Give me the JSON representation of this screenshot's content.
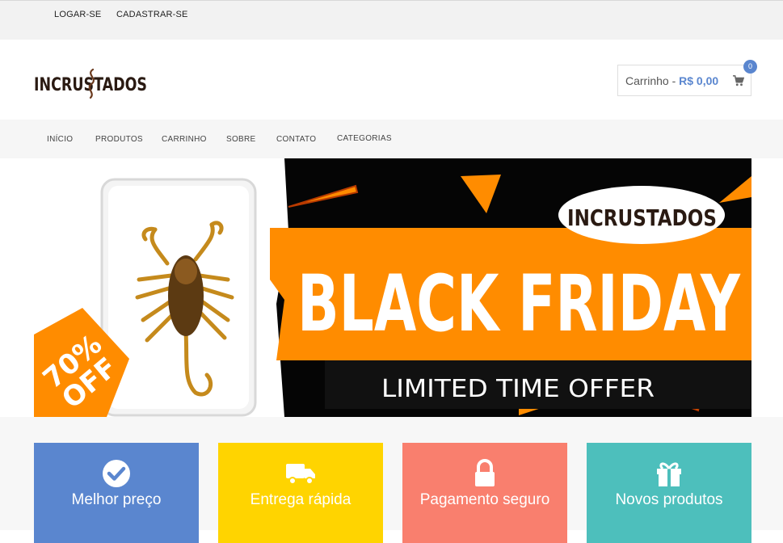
{
  "topbar": {
    "login": "LOGAR-SE",
    "signup": "CADASTRAR-SE"
  },
  "header": {
    "logo_text": "INCRUSTADOS",
    "cart": {
      "label": "Carrinho - ",
      "total": "R$ 0,00",
      "count": "0",
      "icon": "shopping-cart-icon"
    }
  },
  "nav": {
    "items": [
      "INÍCIO",
      "PRODUTOS",
      "CARRINHO",
      "SOBRE",
      "CONTATO",
      "CATEGORIAS"
    ]
  },
  "banner": {
    "brand": "INCRUSTADOS",
    "headline": "BLACK FRIDAY",
    "subline": "LIMITED TIME OFFER",
    "discount": "70%",
    "discount_suffix": "OFF",
    "colors": {
      "orange": "#ff8c00",
      "black": "#050505"
    }
  },
  "features": [
    {
      "label": "Melhor preço",
      "icon": "check-circle-icon",
      "color": "#5a86cf"
    },
    {
      "label": "Entrega rápida",
      "icon": "truck-icon",
      "color": "#ffd400"
    },
    {
      "label": "Pagamento seguro",
      "icon": "lock-icon",
      "color": "#f97f6e"
    },
    {
      "label": "Novos produtos",
      "icon": "gift-icon",
      "color": "#4dbfbc"
    }
  ]
}
